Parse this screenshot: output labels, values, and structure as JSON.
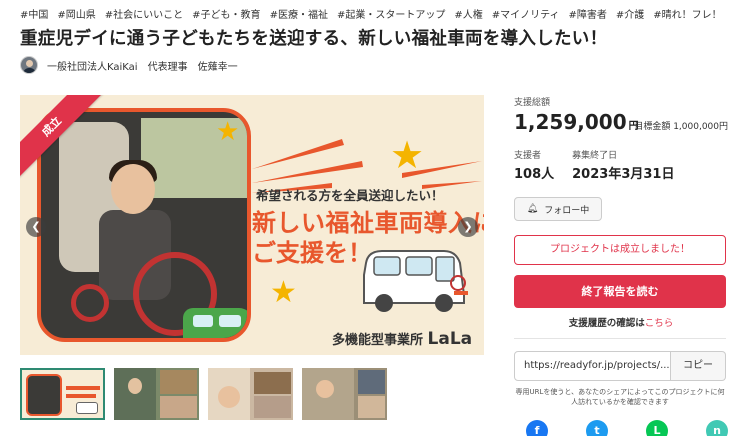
{
  "tags": [
    "#中国",
    "#岡山県",
    "#社会にいいこと",
    "#子ども・教育",
    "#医療・福祉",
    "#起業・スタートアップ",
    "#人権",
    "#マイノリティ",
    "#障害者",
    "#介護",
    "#晴れ！フレ！岡山"
  ],
  "project": {
    "title": "重症児デイに通う子どもたちを送迎する、新しい福祉車両を導入したい！",
    "owner": "一般社団法人KaiKai　代表理事　佐薙幸一"
  },
  "visual": {
    "ribbon": "成立",
    "line1": "希望される方を全員送迎したい！",
    "line2": "新しい福祉車両導入に",
    "line3": "ご支援を！",
    "org_prefix": "多機能型事業所",
    "org_name": "LaLa",
    "prev_icon": "chevron-left-icon",
    "next_icon": "chevron-right-icon"
  },
  "thumbnails": [
    "thumb-1",
    "thumb-2",
    "thumb-3",
    "thumb-4"
  ],
  "stats": {
    "total_label": "支援総額",
    "total_amount": "1,259,000",
    "yen": "円",
    "goal": "目標金額 1,000,000円",
    "supporters_label": "支援者",
    "supporters": "108人",
    "end_label": "募集終了日",
    "end_date": "2023年3月31日"
  },
  "actions": {
    "follow": "フォロー中",
    "success": "プロジェクトは成立しました！",
    "report": "終了報告を読む",
    "history_prefix": "支援履歴の確認は",
    "history_link": "こちら"
  },
  "share": {
    "url": "https://readyfor.jp/projects/...",
    "copy": "コピー",
    "note": "専用URLを使うと、あなたのシェアによってこのプロジェクトに何人訪れているかを確認できます"
  },
  "social": [
    {
      "name": "facebook-icon",
      "glyph": "f"
    },
    {
      "name": "twitter-icon",
      "glyph": "t"
    },
    {
      "name": "line-icon",
      "glyph": "L"
    },
    {
      "name": "note-icon",
      "glyph": "n"
    }
  ],
  "colors": {
    "accent": "#e0334a",
    "orange": "#e8572d",
    "tag_text": "#333333"
  }
}
